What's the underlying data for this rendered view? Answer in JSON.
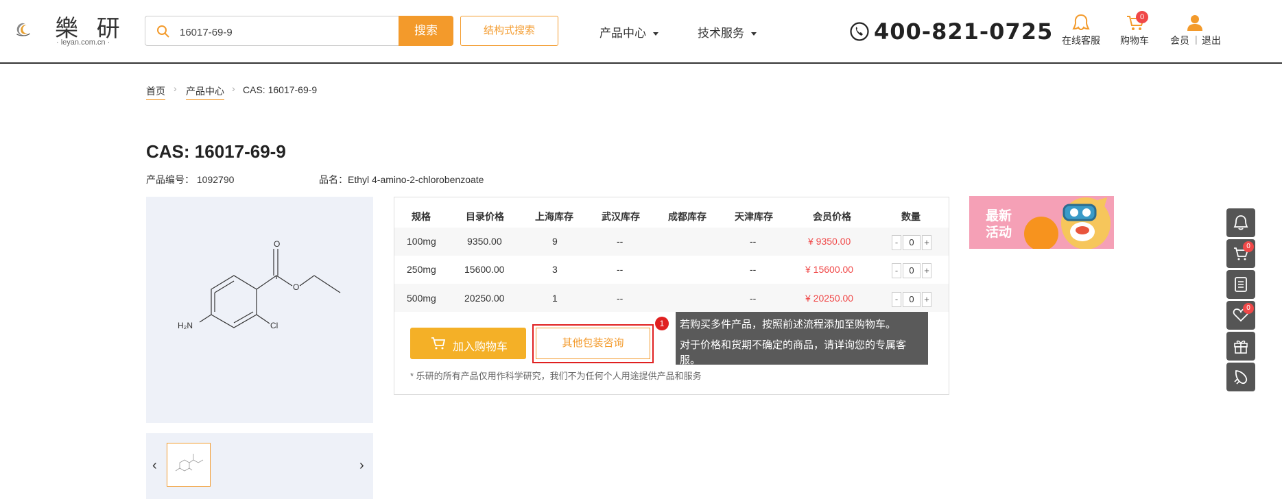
{
  "header": {
    "logo_text": "樂 研",
    "logo_sub": "· leyan.com.cn ·",
    "search_value": "16017-69-9",
    "search_button": "搜索",
    "structure_search_button": "结构式搜索",
    "nav": [
      "产品中心",
      "技术服务"
    ],
    "phone": "400-821-0725",
    "online_service": "在线客服",
    "cart": "购物车",
    "cart_count": "0",
    "member": "会员",
    "separator": "|",
    "logout": "退出"
  },
  "breadcrumb": {
    "home": "首页",
    "products": "产品中心",
    "current": "CAS: 16017-69-9"
  },
  "product": {
    "title": "CAS: 16017-69-9",
    "code_label": "产品编号：",
    "code": "1092790",
    "name_label": "品名：",
    "name": "Ethyl 4-amino-2-chlorobenzoate",
    "structure_labels": {
      "o_top": "O",
      "o_ester": "O",
      "nh2": "H₂N",
      "cl": "Cl"
    }
  },
  "table": {
    "headers": [
      "规格",
      "目录价格",
      "上海库存",
      "武汉库存",
      "成都库存",
      "天津库存",
      "会员价格",
      "数量"
    ],
    "rows": [
      {
        "spec": "100mg",
        "list_price": "9350.00",
        "shanghai": "9",
        "wuhan": "--",
        "chengdu": "",
        "tianjin": "--",
        "member_price": "¥ 9350.00",
        "qty": "0"
      },
      {
        "spec": "250mg",
        "list_price": "15600.00",
        "shanghai": "3",
        "wuhan": "--",
        "chengdu": "",
        "tianjin": "--",
        "member_price": "¥ 15600.00",
        "qty": "0"
      },
      {
        "spec": "500mg",
        "list_price": "20250.00",
        "shanghai": "1",
        "wuhan": "--",
        "chengdu": "",
        "tianjin": "--",
        "member_price": "¥ 20250.00",
        "qty": "0"
      }
    ],
    "minus": "-",
    "plus": "+"
  },
  "actions": {
    "add_to_cart": "加入购物车",
    "other_packaging": "其他包装咨询",
    "notice": "* 乐研的所有产品仅用作科学研究，我们不为任何个人用途提供产品和服务"
  },
  "tooltip": {
    "step": "1",
    "line1": "若购买多件产品，按照前述流程添加至购物车。",
    "line2": "对于价格和货期不确定的商品，请详询您的专属客服。"
  },
  "promo": {
    "line1": "最新",
    "line2": "活动"
  },
  "sidebar": {
    "cart_count": "0",
    "favorites_count": "0"
  },
  "colors": {
    "accent": "#f39a2b",
    "price": "#f04848",
    "sidebar": "#555555"
  }
}
